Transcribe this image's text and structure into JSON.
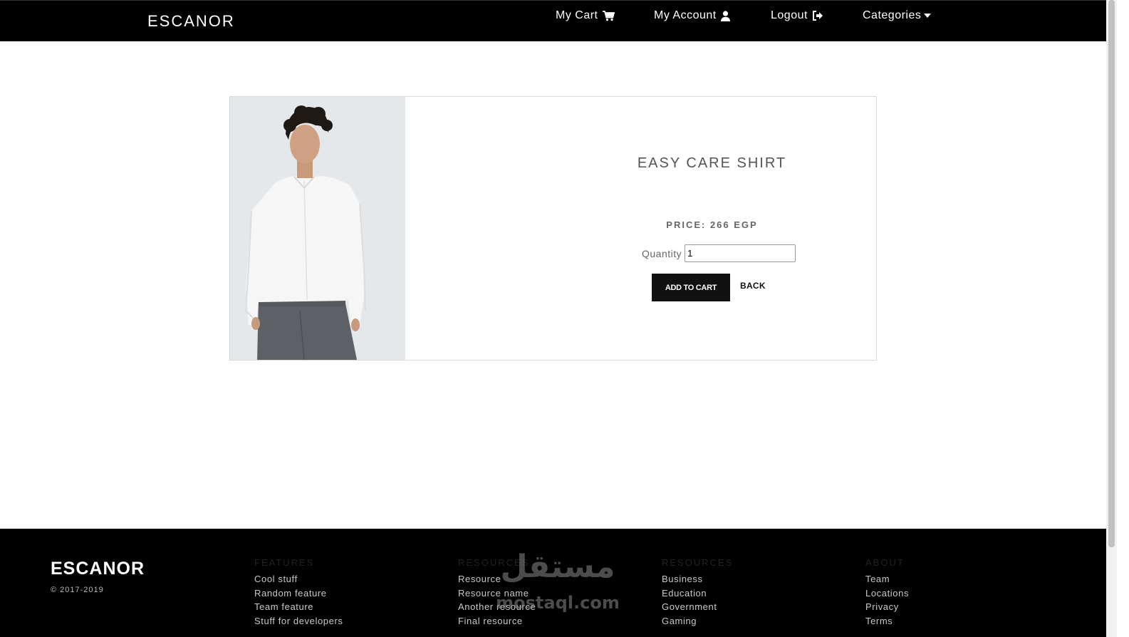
{
  "nav": {
    "brand": "ESCANOR",
    "cart": "My Cart",
    "account": "My Account",
    "logout": "Logout",
    "categories": "Categories"
  },
  "product": {
    "image_icon": "product-photo-shirt",
    "title": "EASY CARE SHIRT",
    "price": "PRICE: 266 EGP",
    "quantity_label": "Quantity",
    "quantity_value": "1",
    "add_to_cart": "ADD TO CART",
    "back": "BACK"
  },
  "footer": {
    "brand": "ESCANOR",
    "copyright": "© 2017-2019",
    "columns": [
      {
        "heading": "FEATURES",
        "links": [
          "Cool stuff",
          "Random feature",
          "Team feature",
          "Stuff for developers"
        ]
      },
      {
        "heading": "RESOURCES",
        "links": [
          "Resource",
          "Resource name",
          "Another resource",
          "Final resource"
        ]
      },
      {
        "heading": "RESOURCES",
        "links": [
          "Business",
          "Education",
          "Government",
          "Gaming"
        ]
      },
      {
        "heading": "ABOUT",
        "links": [
          "Team",
          "Locations",
          "Privacy",
          "Terms"
        ]
      }
    ]
  },
  "watermark": {
    "arabic": "مستقل",
    "latin": "mostaql.com"
  },
  "colors": {
    "navbar": "#000000",
    "footer": "#000000",
    "button": "#111111"
  }
}
